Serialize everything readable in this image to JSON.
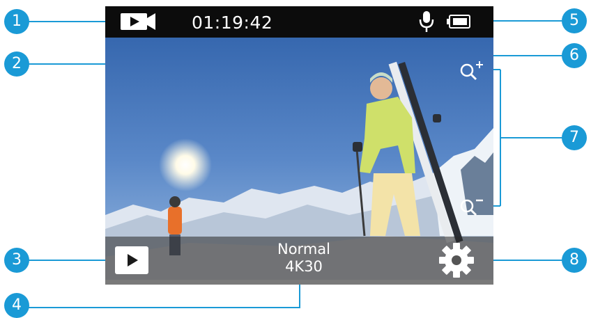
{
  "screen": {
    "timer": "01:19:42",
    "mode_name": "Normal",
    "mode_resolution": "4K30",
    "icons": {
      "video_mode": "video-camera-icon",
      "microphone": "microphone-icon",
      "battery": "battery-icon",
      "zoom_in": "zoom-in-icon",
      "zoom_out": "zoom-out-icon",
      "playback": "playback-icon",
      "settings": "gear-icon"
    }
  },
  "callouts": [
    "1",
    "2",
    "3",
    "4",
    "5",
    "6",
    "7",
    "8"
  ],
  "colors": {
    "callout": "#1a9ad6",
    "bar": "#0c0c0c",
    "sky": "#3f6fb5"
  }
}
